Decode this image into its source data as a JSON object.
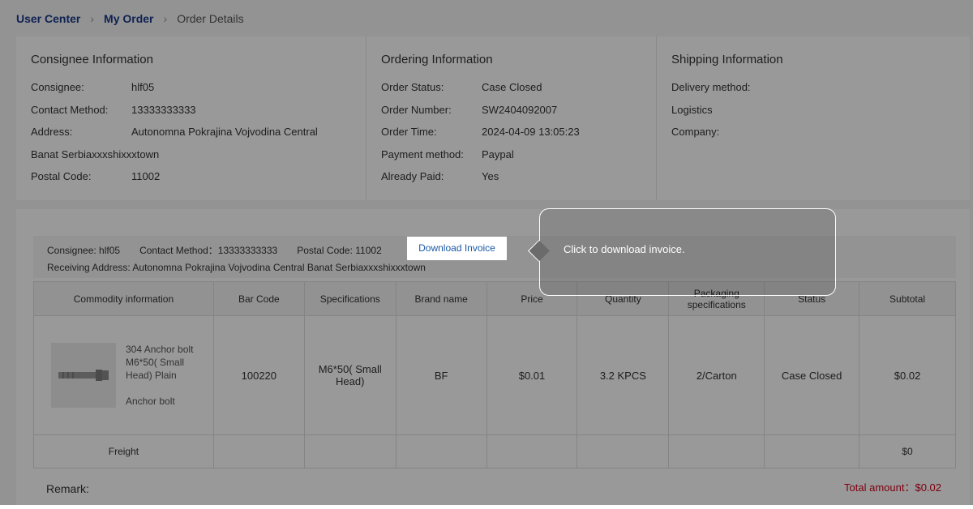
{
  "breadcrumb": {
    "home": "User Center",
    "orders": "My Order",
    "current": "Order Details"
  },
  "consignee_info": {
    "title": "Consignee Information",
    "consignee_label": "Consignee:",
    "consignee": "hlf05",
    "contact_label": "Contact Method:",
    "contact": "13333333333",
    "address_label": "Address:",
    "address_line1": "Autonomna Pokrajina Vojvodina Central",
    "address_line2": "Banat Serbiaxxxshixxxtown",
    "postal_label": "Postal Code:",
    "postal": "11002"
  },
  "ordering_info": {
    "title": "Ordering Information",
    "status_label": "Order Status:",
    "status": "Case Closed",
    "number_label": "Order Number:",
    "number": "SW2404092007",
    "time_label": "Order Time:",
    "time": "2024-04-09 13:05:23",
    "payment_label": "Payment method:",
    "payment": "Paypal",
    "paid_label": "Already Paid:",
    "paid": "Yes"
  },
  "shipping_info": {
    "title": "Shipping Information",
    "delivery_label": "Delivery method:",
    "logistics_label": "Logistics",
    "company_label": "Company:"
  },
  "order_head": {
    "consignee": "Consignee: hlf05",
    "contact": "Contact Method：13333333333",
    "postal": "Postal Code: 11002",
    "download": "Download Invoice",
    "address": "Receiving Address: Autonomna Pokrajina Vojvodina Central Banat Serbiaxxxshixxxtown"
  },
  "table": {
    "headers": [
      "Commodity information",
      "Bar Code",
      "Specifications",
      "Brand name",
      "Price",
      "Quantity",
      "Packaging specifications",
      "Status",
      "Subtotal"
    ],
    "row": {
      "name": "304 Anchor bolt M6*50( Small Head) Plain",
      "category": "Anchor bolt",
      "bar_code": "100220",
      "spec": "M6*50( Small Head)",
      "brand": "BF",
      "price": "$0.01",
      "quantity": "3.2 KPCS",
      "packaging": "2/Carton",
      "status": "Case Closed",
      "subtotal": "$0.02"
    },
    "freight_label": "Freight",
    "freight_value": "$0"
  },
  "remark_label": "Remark:",
  "total": "Total amount：$0.02",
  "tooltip": {
    "text": "Click to download invoice."
  },
  "colors": {
    "link": "#1a3a8a",
    "total": "#d0021b",
    "overlay": "rgba(0,0,0,0.4)"
  }
}
